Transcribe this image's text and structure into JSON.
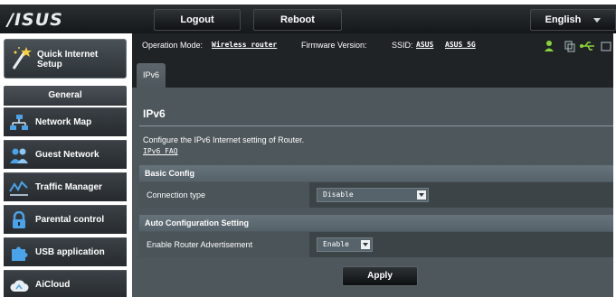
{
  "header": {
    "logo": "/ISUS",
    "logout_label": "Logout",
    "reboot_label": "Reboot",
    "language": "English"
  },
  "sidebar": {
    "quick_setup": "Quick Internet Setup",
    "general_label": "General",
    "items": [
      {
        "label": "Network Map",
        "icon": "network-map-icon"
      },
      {
        "label": "Guest Network",
        "icon": "guest-network-icon"
      },
      {
        "label": "Traffic Manager",
        "icon": "traffic-manager-icon"
      },
      {
        "label": "Parental control",
        "icon": "lock-icon"
      },
      {
        "label": "USB application",
        "icon": "puzzle-icon"
      },
      {
        "label": "AiCloud",
        "icon": "cloud-icon"
      }
    ]
  },
  "status": {
    "op_mode_label": "Operation Mode:",
    "op_mode_value": "Wireless router",
    "firmware_label": "Firmware Version:",
    "ssid_label": "SSID:",
    "ssid_1": "ASUS",
    "ssid_2": "ASUS_5G"
  },
  "main": {
    "tab_label": "IPv6",
    "page_title": "IPv6",
    "description": "Configure the IPv6 Internet setting of Router.",
    "faq_link": "IPv6 FAQ",
    "basic_config_header": "Basic Config",
    "connection_type_label": "Connection type",
    "connection_type_value": "Disable",
    "auto_config_header": "Auto Configuration Setting",
    "router_adv_label": "Enable Router Advertisement",
    "router_adv_value": "Enable",
    "apply_label": "Apply"
  },
  "colors": {
    "topbar": "#15181a",
    "main_bg": "#4e575c",
    "section_header": "#5d6a71",
    "status_green": "#8bd23a"
  }
}
